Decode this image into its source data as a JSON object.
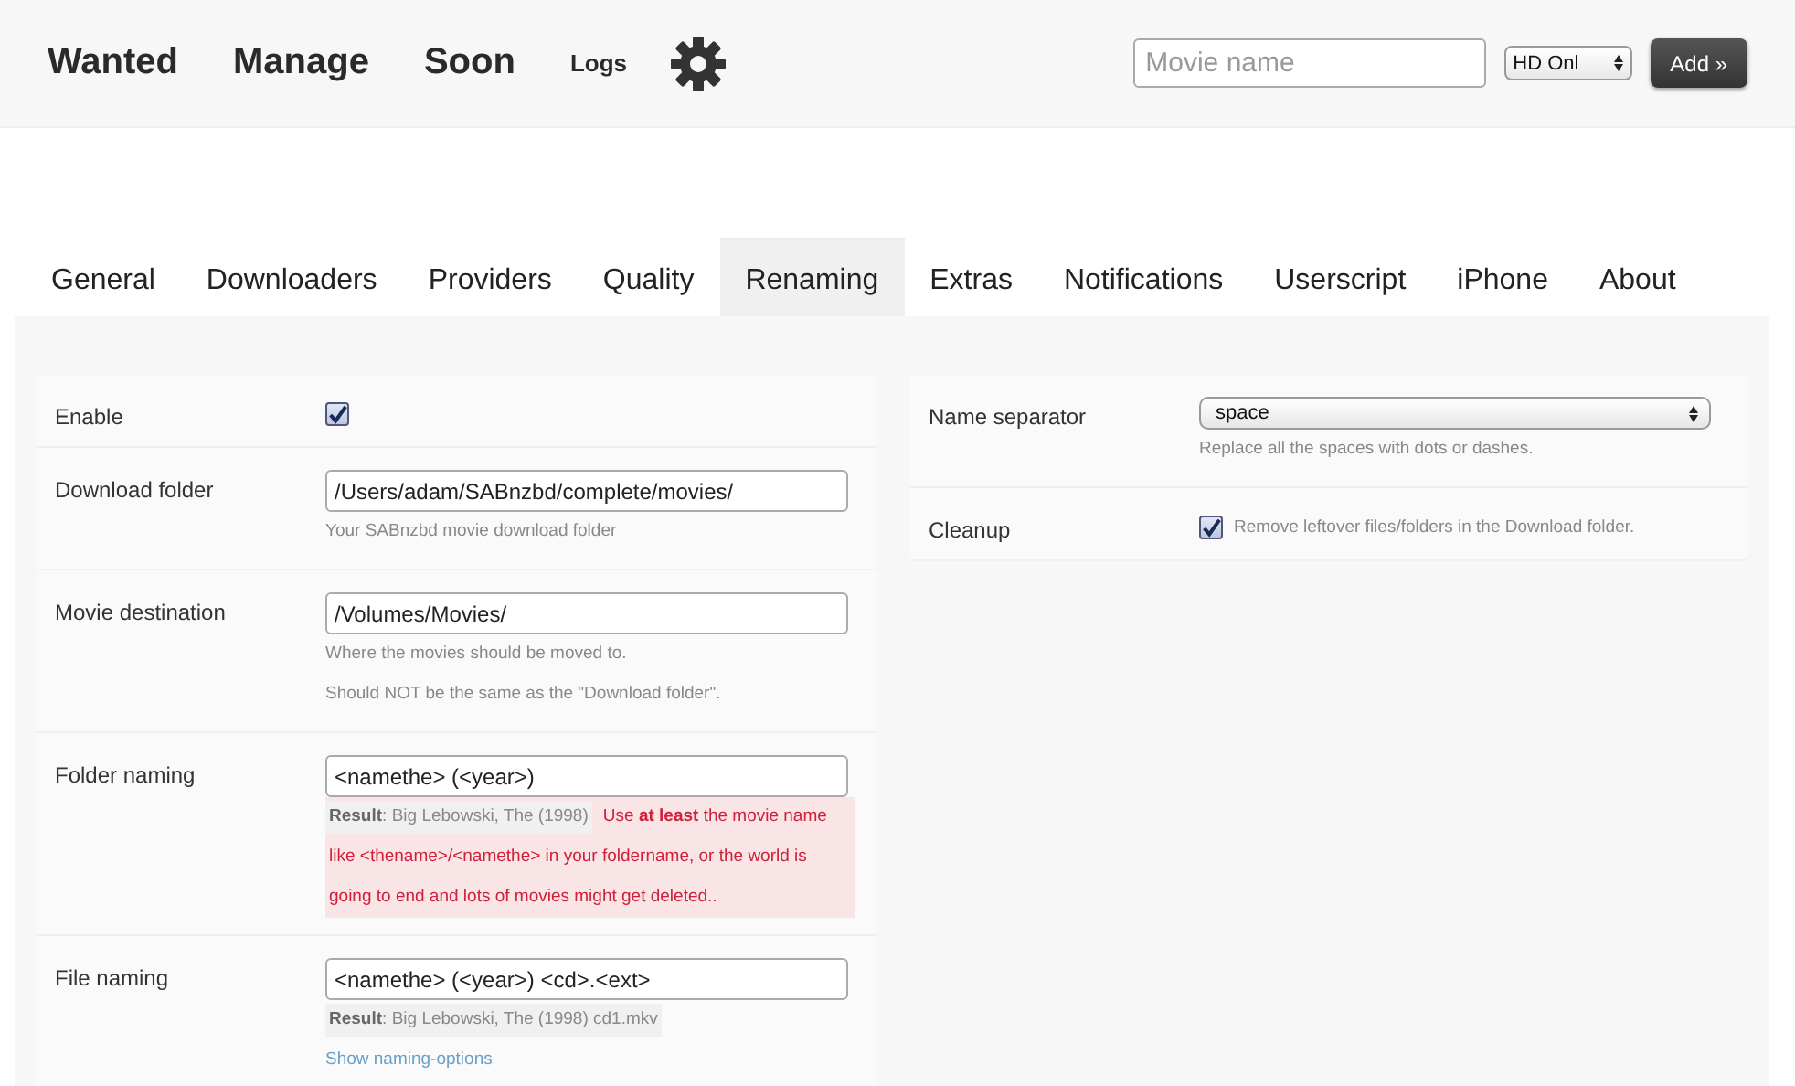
{
  "nav": [
    {
      "label": "Wanted",
      "kind": "big"
    },
    {
      "label": "Manage",
      "kind": "big"
    },
    {
      "label": "Soon",
      "kind": "big"
    },
    {
      "label": "Logs",
      "kind": "small"
    }
  ],
  "search": {
    "placeholder": "Movie name"
  },
  "quality_select": {
    "value": "HD Onl"
  },
  "add_button": "Add »",
  "tabs": [
    {
      "label": "General",
      "selected": false
    },
    {
      "label": "Downloaders",
      "selected": false
    },
    {
      "label": "Providers",
      "selected": false
    },
    {
      "label": "Quality",
      "selected": false
    },
    {
      "label": "Renaming",
      "selected": true
    },
    {
      "label": "Extras",
      "selected": false
    },
    {
      "label": "Notifications",
      "selected": false
    },
    {
      "label": "Userscript",
      "selected": false
    },
    {
      "label": "iPhone",
      "selected": false
    },
    {
      "label": "About",
      "selected": false
    }
  ],
  "left_settings": [
    {
      "label": "Enable",
      "kind": "checkbox",
      "checked": true
    },
    {
      "label": "Download folder",
      "kind": "text",
      "value": "/Users/adam/SABnzbd/complete/movies/",
      "hints": [
        {
          "kind": "note",
          "text": "Your SABnzbd movie download folder"
        }
      ]
    },
    {
      "label": "Movie destination",
      "kind": "text",
      "value": "/Volumes/Movies/",
      "hints": [
        {
          "kind": "note",
          "text": "Where the movies should be moved to."
        },
        {
          "kind": "note",
          "text": "Should NOT be the same as the \"Download folder\"."
        }
      ]
    },
    {
      "label": "Folder naming",
      "kind": "text",
      "value": "<namethe> (<year>)",
      "hints": [
        {
          "kind": "result",
          "text": "**Result**: Big Lebowski, The (1998)"
        },
        {
          "kind": "warning",
          "text": "Use **at least** the movie name like <thename>/<namethe> in your foldername, or the world is going to end and lots of movies might get deleted.."
        }
      ]
    },
    {
      "label": "File naming",
      "kind": "text",
      "value": "<namethe> (<year>) <cd>.<ext>",
      "hints": [
        {
          "kind": "result",
          "text": "**Result**: Big Lebowski, The (1998) cd1.mkv"
        },
        {
          "kind": "link",
          "text": "Show naming-options"
        }
      ]
    }
  ],
  "right_settings": [
    {
      "label": "Name separator",
      "kind": "select",
      "value": "space",
      "hints": [
        {
          "kind": "note",
          "text": "Replace all the spaces with dots or dashes."
        }
      ]
    },
    {
      "label": "Cleanup",
      "kind": "checkbox",
      "checked": true,
      "inline_note": "Remove leftover files/folders in the Download folder."
    }
  ]
}
